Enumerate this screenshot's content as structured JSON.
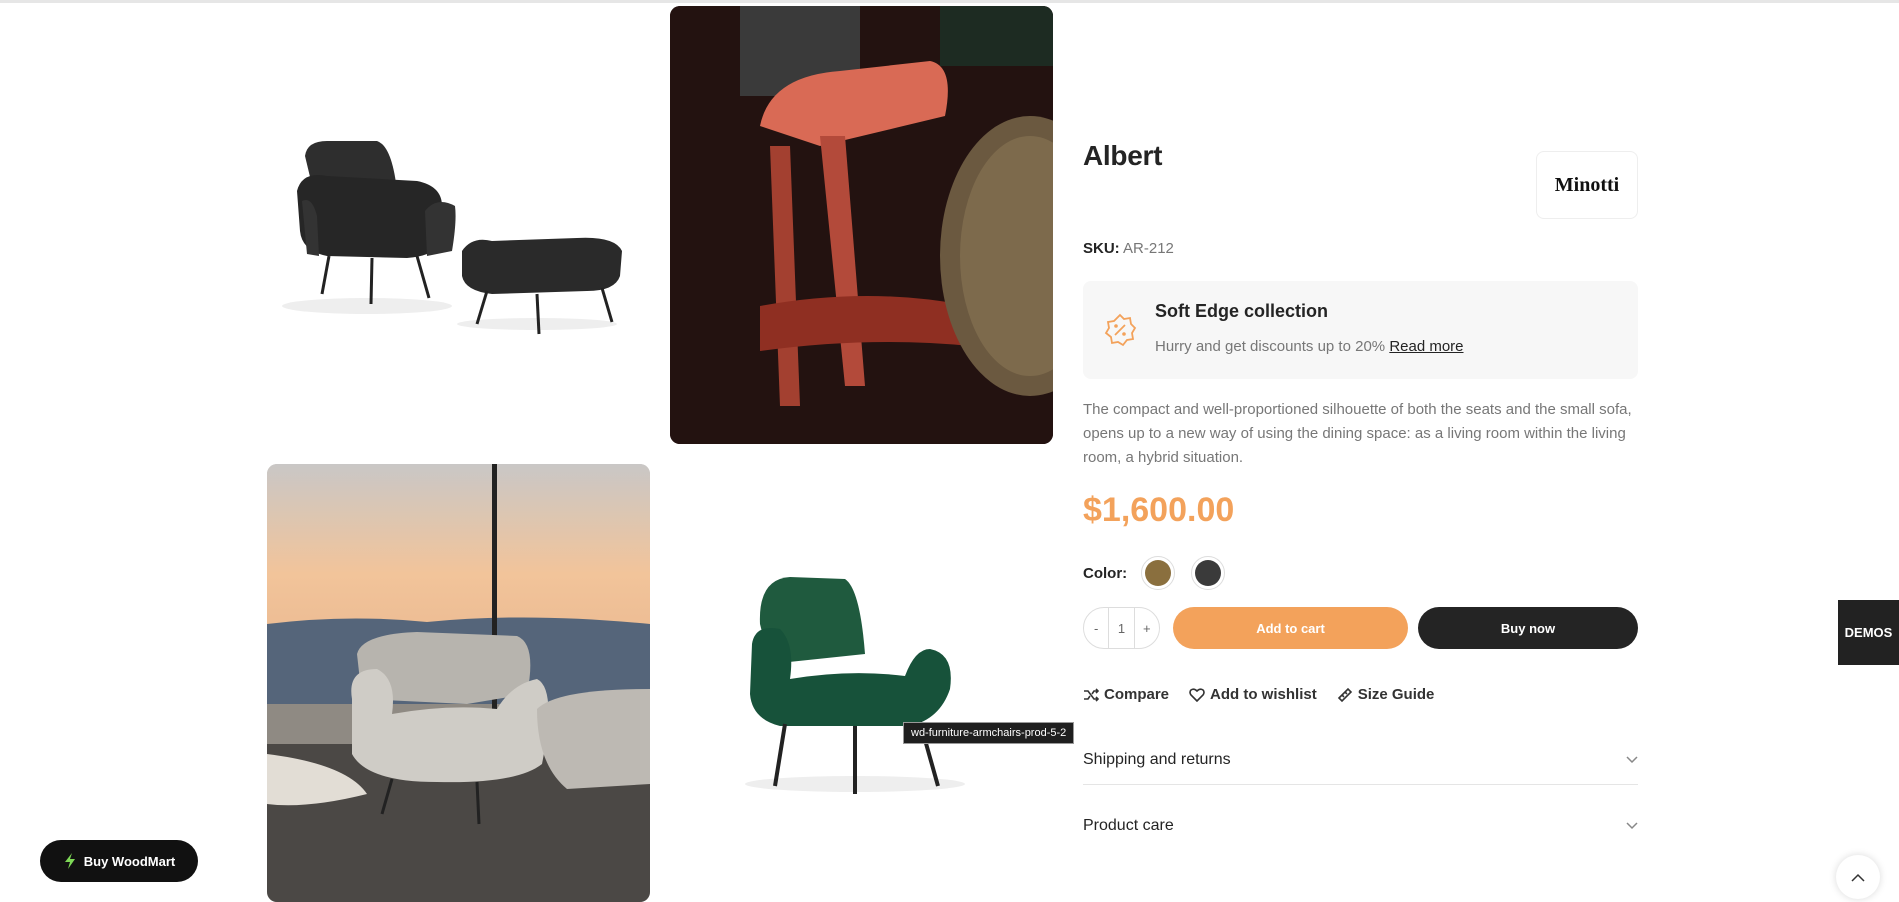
{
  "product": {
    "title": "Albert",
    "brand": "Minotti",
    "sku_label": "SKU:",
    "sku_value": "AR-212",
    "promo_title": "Soft Edge collection",
    "promo_text": "Hurry and get discounts up to 20%",
    "promo_link": "Read more",
    "description": "The compact and well-proportioned silhouette of both the seats and the small sofa, opens up to a new way of using the dining space: as a living room within the living room, a hybrid situation.",
    "price": "$1,600.00",
    "color_label": "Color:",
    "swatches": [
      {
        "name": "brown",
        "color": "#8a6f3e"
      },
      {
        "name": "dark",
        "color": "#3a3a3a"
      }
    ],
    "qty_minus": "-",
    "qty_value": "1",
    "qty_plus": "+",
    "add_to_cart": "Add to cart",
    "buy_now": "Buy now",
    "actions": {
      "compare": "Compare",
      "wishlist": "Add to wishlist",
      "size_guide": "Size Guide"
    },
    "accordion": [
      {
        "label": "Shipping and returns"
      },
      {
        "label": "Product care"
      }
    ]
  },
  "gallery": {
    "tooltip": "wd-furniture-armchairs-prod-5-2"
  },
  "widgets": {
    "demos_label": "DEMOS",
    "buy_woodmart": "Buy WoodMart"
  },
  "colors": {
    "accent": "#f3a25b",
    "dark": "#242424"
  }
}
